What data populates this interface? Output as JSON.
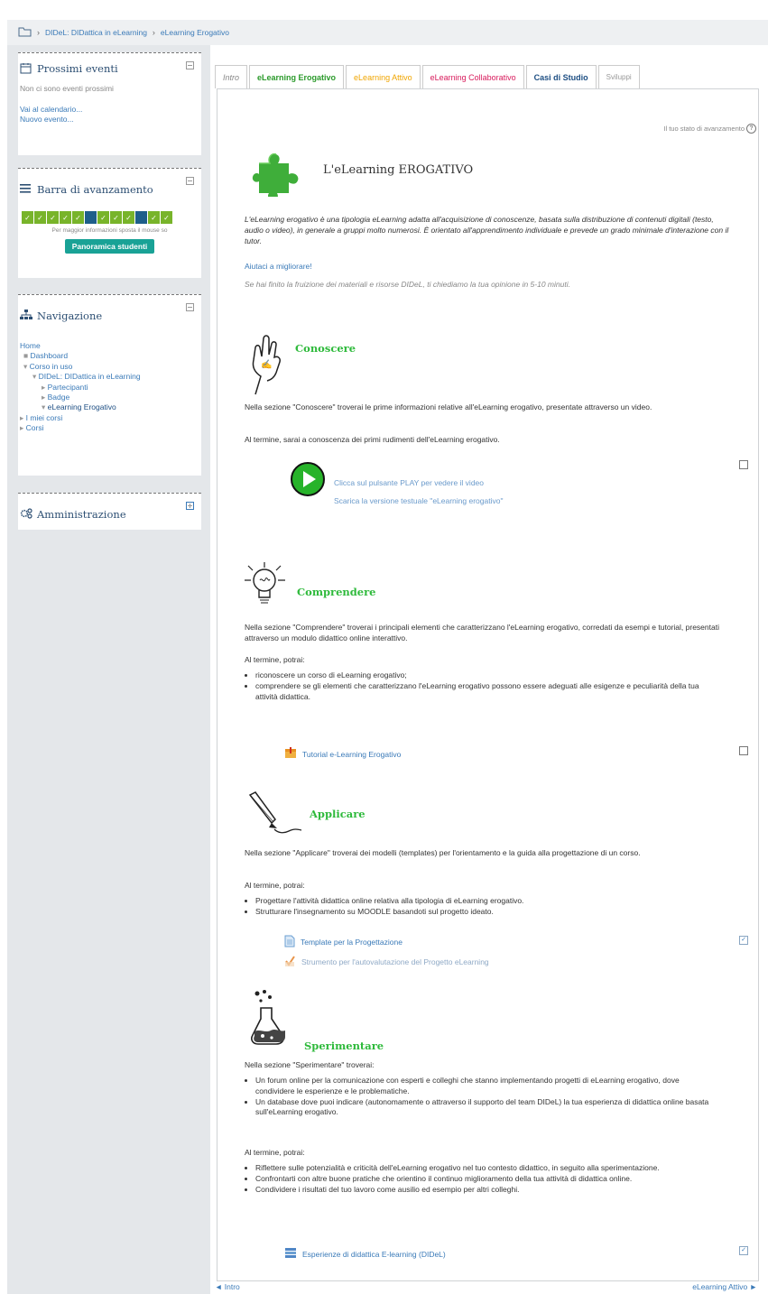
{
  "breadcrumb": {
    "items": [
      "DIDeL: DIDattica in eLearning",
      "eLearning Erogativo"
    ]
  },
  "events_block": {
    "title": "Prossimi eventi",
    "empty_text": "Non ci sono eventi prossimi",
    "calendar_link": "Vai al calendario...",
    "new_event_link": "Nuovo evento..."
  },
  "progress_block": {
    "title": "Barra di avanzamento",
    "cells": [
      "done",
      "done",
      "done",
      "done",
      "done",
      "todo",
      "done",
      "done",
      "done",
      "todo",
      "done",
      "done"
    ],
    "hint": "Per maggior informazioni sposta il mouse so",
    "button": "Panoramica studenti"
  },
  "nav_block": {
    "title": "Navigazione",
    "items": [
      "Home",
      "Dashboard",
      "Corso in uso",
      "DIDeL: DIDattica in eLearning",
      "Partecipanti",
      "Badge",
      "eLearning Erogativo",
      "I miei corsi",
      "Corsi"
    ]
  },
  "admin_block": {
    "title": "Amministrazione"
  },
  "tabs": [
    "Intro",
    "eLearning Erogativo",
    "eLearning Attivo",
    "eLearning Collaborativo",
    "Casi di Studio",
    "Sviluppi"
  ],
  "status_text": "Il tuo stato di avanzamento",
  "heading": "L'eLearning EROGATIVO",
  "intro_text": "L'eLearning erogativo è una tipologia eLearning adatta all'acquisizione di conoscenze, basata sulla distribuzione di contenuti digitali (testo, audio o video), in generale a gruppi molto numerosi.  È orientato all'apprendimento individuale e prevede un grado minimale d'interazione con il tutor.",
  "feedback": {
    "link": "Aiutaci a migliorare!",
    "note": "Se hai finito la fruizione dei materiali e risorse DIDeL, ti chiediamo la tua opinione in 5-10 minuti."
  },
  "conoscere": {
    "title": "Conoscere",
    "p1": "Nella sezione \"Conoscere\" troverai le prime informazioni relative all'eLearning erogativo, presentate attraverso un video.",
    "p2": "Al termine, sarai a conoscenza dei primi rudimenti dell'eLearning erogativo.",
    "link1": "Clicca sul pulsante PLAY per vedere il video",
    "link2": "Scarica la versione testuale \"eLearning erogativo\""
  },
  "comprendere": {
    "title": "Comprendere",
    "p1": "Nella sezione \"Comprendere\" troverai i principali elementi che caratterizzano l'eLearning erogativo, corredati da esempi e tutorial, presentati attraverso un modulo didattico online interattivo.",
    "p2": "Al termine, potrai:",
    "bullets": [
      "riconoscere un corso di eLearning erogativo;",
      "comprendere se gli elementi che caratterizzano l'eLearning erogativo possono essere adeguati alle esigenze e peculiarità della tua attività didattica."
    ],
    "activity": "Tutorial e-Learning Erogativo"
  },
  "applicare": {
    "title": "Applicare",
    "p1": "Nella sezione \"Applicare\" troverai dei modelli (templates) per l'orientamento e la guida alla progettazione di un corso.",
    "p2": "Al termine, potrai:",
    "bullets": [
      "Progettare l'attività didattica online relativa alla tipologia di eLearning erogativo.",
      "Strutturare l'insegnamento su MOODLE basandoti sul progetto ideato."
    ],
    "activity1": "Template per la Progettazione",
    "activity2": "Strumento per l'autovalutazione del Progetto eLearning"
  },
  "sperimentare": {
    "title": "Sperimentare",
    "p1": "Nella sezione \"Sperimentare\" troverai:",
    "bullets1": [
      "Un forum online per la comunicazione con esperti e colleghi che stanno implementando progetti di eLearning erogativo, dove condividere le esperienze e le problematiche.",
      "Un database dove puoi indicare (autonomamente o attraverso il supporto del team DIDeL) la tua esperienza di didattica online basata sull'eLearning erogativo."
    ],
    "p2": "Al termine, potrai:",
    "bullets2": [
      "Riflettere sulle potenzialità e criticità dell'eLearning erogativo nel tuo contesto didattico, in seguito alla sperimentazione.",
      "Confrontarti con altre buone pratiche che orientino il continuo miglioramento della tua attività di didattica online.",
      "Condividere i risultati del tuo lavoro come ausilio ed esempio per altri colleghi."
    ],
    "activity": "Esperienze di didattica E-learning (DIDeL)"
  },
  "footer_nav": {
    "prev": "◄ Intro",
    "next": "eLearning Attivo ►"
  },
  "colors": {
    "green": "#2fba3c",
    "link": "#3a7ab8",
    "teal": "#19a296",
    "progress_done": "#78b42a",
    "progress_todo": "#1e5f8a"
  }
}
